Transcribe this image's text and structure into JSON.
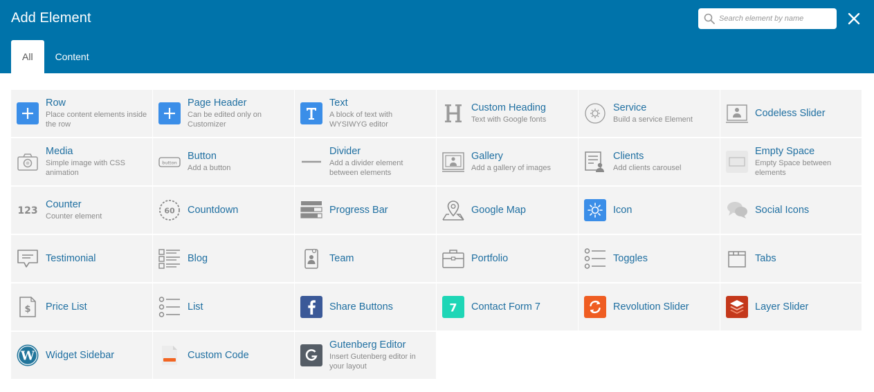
{
  "header": {
    "title": "Add Element",
    "search_placeholder": "Search element by name",
    "tabs": [
      {
        "label": "All",
        "active": true
      },
      {
        "label": "Content",
        "active": false
      }
    ]
  },
  "colors": {
    "header_bg": "#0073aa",
    "tile_bg": "#f3f3f3",
    "name_text": "#1f6fa1",
    "desc_text": "#8a8a8a",
    "accent_blue": "#3b8ee8"
  },
  "elements": [
    {
      "name": "Row",
      "desc": "Place content elements inside the row",
      "icon": "plus-icon"
    },
    {
      "name": "Page Header",
      "desc": "Can be edited only on Customizer",
      "icon": "plus-icon"
    },
    {
      "name": "Text",
      "desc": "A block of text with WYSIWYG editor",
      "icon": "text-icon"
    },
    {
      "name": "Custom Heading",
      "desc": "Text with Google fonts",
      "icon": "heading-icon"
    },
    {
      "name": "Service",
      "desc": "Build a service Element",
      "icon": "service-icon"
    },
    {
      "name": "Codeless Slider",
      "desc": "",
      "icon": "slider-icon"
    },
    {
      "name": "Media",
      "desc": "Simple image with CSS animation",
      "icon": "camera-icon"
    },
    {
      "name": "Button",
      "desc": "Add a button",
      "icon": "button-icon"
    },
    {
      "name": "Divider",
      "desc": "Add a divider element between elements",
      "icon": "divider-icon"
    },
    {
      "name": "Gallery",
      "desc": "Add a gallery of images",
      "icon": "gallery-icon"
    },
    {
      "name": "Clients",
      "desc": "Add clients carousel",
      "icon": "clients-icon"
    },
    {
      "name": "Empty Space",
      "desc": "Empty Space between elements",
      "icon": "empty-space-icon"
    },
    {
      "name": "Counter",
      "desc": "Counter element",
      "icon": "counter-icon"
    },
    {
      "name": "Countdown",
      "desc": "",
      "icon": "countdown-icon"
    },
    {
      "name": "Progress Bar",
      "desc": "",
      "icon": "progress-bar-icon"
    },
    {
      "name": "Google Map",
      "desc": "",
      "icon": "map-icon"
    },
    {
      "name": "Icon",
      "desc": "",
      "icon": "sun-icon"
    },
    {
      "name": "Social Icons",
      "desc": "",
      "icon": "chat-bubbles-icon"
    },
    {
      "name": "Testimonial",
      "desc": "",
      "icon": "testimonial-icon"
    },
    {
      "name": "Blog",
      "desc": "",
      "icon": "blog-icon"
    },
    {
      "name": "Team",
      "desc": "",
      "icon": "team-icon"
    },
    {
      "name": "Portfolio",
      "desc": "",
      "icon": "briefcase-icon"
    },
    {
      "name": "Toggles",
      "desc": "",
      "icon": "toggles-icon"
    },
    {
      "name": "Tabs",
      "desc": "",
      "icon": "tabs-icon"
    },
    {
      "name": "Price List",
      "desc": "",
      "icon": "price-list-icon"
    },
    {
      "name": "List",
      "desc": "",
      "icon": "list-icon"
    },
    {
      "name": "Share Buttons",
      "desc": "",
      "icon": "facebook-icon"
    },
    {
      "name": "Contact Form 7",
      "desc": "",
      "icon": "contact-form-7-icon"
    },
    {
      "name": "Revolution Slider",
      "desc": "",
      "icon": "revolution-slider-icon"
    },
    {
      "name": "Layer Slider",
      "desc": "",
      "icon": "layer-slider-icon"
    },
    {
      "name": "Widget Sidebar",
      "desc": "",
      "icon": "wordpress-icon"
    },
    {
      "name": "Custom Code",
      "desc": "",
      "icon": "code-file-icon"
    },
    {
      "name": "Gutenberg Editor",
      "desc": "Insert Gutenberg editor in your layout",
      "icon": "gutenberg-icon"
    }
  ]
}
